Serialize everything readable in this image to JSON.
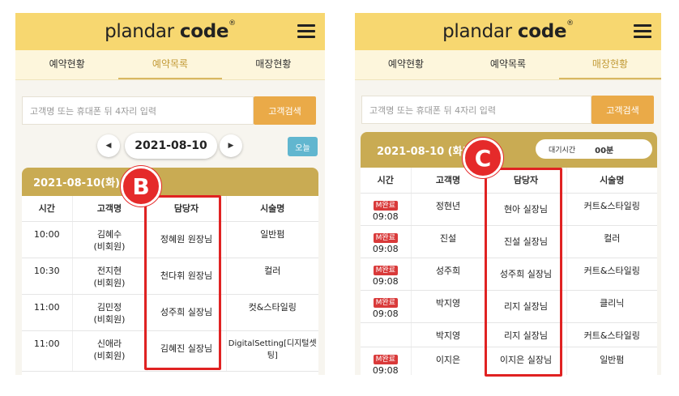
{
  "brand": {
    "name_light": "plandar ",
    "name_bold": "code",
    "mark": "®"
  },
  "left": {
    "tabs": [
      {
        "label": "예약현황",
        "active": false
      },
      {
        "label": "예약목록",
        "active": true
      },
      {
        "label": "매장현황",
        "active": false
      }
    ],
    "search": {
      "placeholder": "고객명 또는 휴대폰 뒤 4자리 입력",
      "button": "고객검색"
    },
    "date_nav": {
      "prev": "◀",
      "date": "2021-08-10",
      "next": "▶",
      "today": "오늘"
    },
    "card_title": "2021-08-10(화)",
    "columns": [
      "시간",
      "고객명",
      "담당자",
      "시술명"
    ],
    "rows": [
      {
        "time": "10:00",
        "name": "김혜수",
        "member": "(비회원)",
        "staff": "정혜원 원장님",
        "service": "일반펌",
        "service2": ""
      },
      {
        "time": "10:30",
        "name": "전지현",
        "member": "(비회원)",
        "staff": "천다휘 원장님",
        "service": "컬러",
        "service2": ""
      },
      {
        "time": "11:00",
        "name": "김민정",
        "member": "(비회원)",
        "staff": "성주희 실장님",
        "service": "컷&스타일링",
        "service2": ""
      },
      {
        "time": "11:00",
        "name": "신애라",
        "member": "(비회원)",
        "staff": "김혜진 실장님",
        "service": "DigitalSetting[디지털셋",
        "service2": "팅]"
      }
    ],
    "marker": "B"
  },
  "right": {
    "tabs": [
      {
        "label": "예약현황",
        "active": false
      },
      {
        "label": "예약목록",
        "active": false
      },
      {
        "label": "매장현황",
        "active": true
      }
    ],
    "search": {
      "placeholder": "고객명 또는 휴대폰 뒤 4자리 입력",
      "button": "고객검색"
    },
    "card_title": "2021-08-10 (화)",
    "wait": {
      "label": "대기시간",
      "value": "00분"
    },
    "columns": [
      "시간",
      "고객명",
      "담당자",
      "시술명"
    ],
    "rows": [
      {
        "badge": "M완료",
        "time": "09:08",
        "name": "정현년",
        "staff": "현아 실장님",
        "service": "커트&스타일링"
      },
      {
        "badge": "M완료",
        "time": "09:08",
        "name": "진설",
        "staff": "진설 실장님",
        "service": "컬러"
      },
      {
        "badge": "M완료",
        "time": "09:08",
        "name": "성주희",
        "staff": "성주희 실장님",
        "service": "커트&스타일링"
      },
      {
        "badge": "M완료",
        "time": "09:08",
        "name": "박지영",
        "staff": "리지 실장님",
        "service": "클리닉"
      },
      {
        "badge": "",
        "time": "",
        "name": "박지영",
        "staff": "리지 실장님",
        "service": "커트&스타일링"
      },
      {
        "badge": "M완료",
        "time": "09:08",
        "name": "이지은",
        "staff": "이지은 실장님",
        "service": "일반펌"
      }
    ],
    "marker": "C"
  },
  "colors": {
    "brand_yellow": "#f7d770",
    "card_header": "#c9ab53",
    "search_button": "#eaaa48",
    "today_button": "#61b6cf",
    "highlight_red": "#e02222",
    "badge_red": "#d93a3a"
  }
}
